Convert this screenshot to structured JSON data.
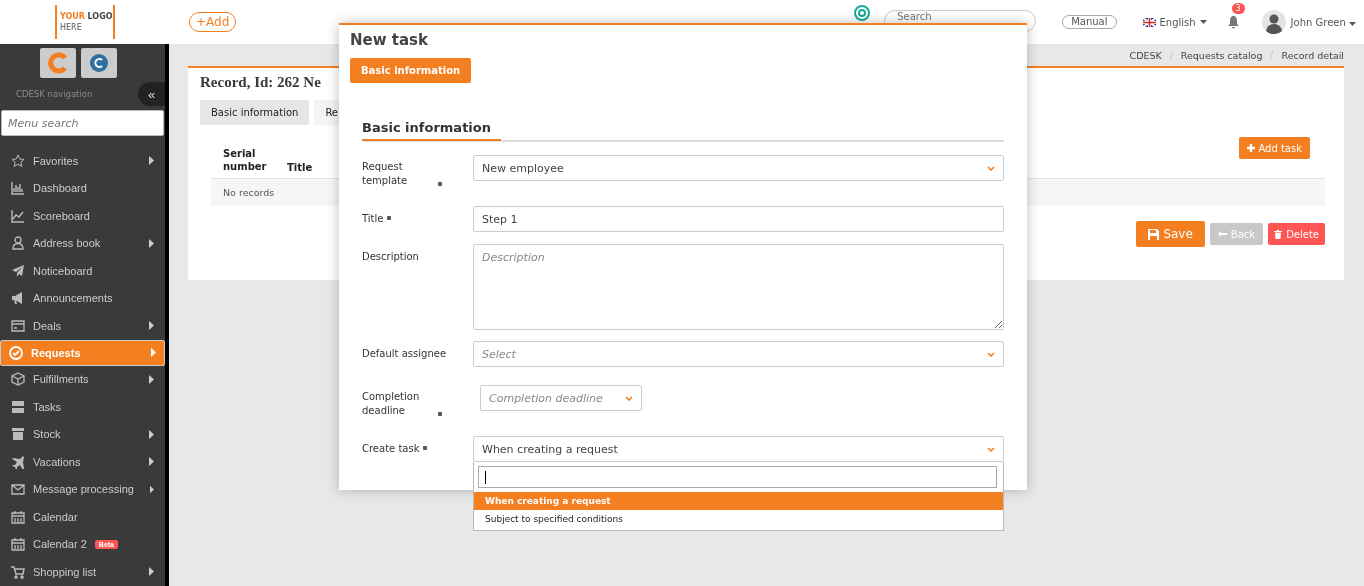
{
  "header": {
    "logo": {
      "word_1": "YOUR",
      "word_2": "LOGO",
      "word_3": "HERE"
    },
    "add_button": "+Add",
    "search": {
      "placeholder": "Search"
    },
    "manual_button": "Manual",
    "language": "English",
    "notifications": "3",
    "user": "John Green"
  },
  "sidebar": {
    "caption": "CDESK navigation",
    "collapse": "«",
    "menu_search": {
      "placeholder": "Menu search"
    },
    "items": [
      {
        "label": "Favorites",
        "submenu": true,
        "selected": false
      },
      {
        "label": "Dashboard",
        "submenu": false,
        "selected": false
      },
      {
        "label": "Scoreboard",
        "submenu": false,
        "selected": false
      },
      {
        "label": "Address book",
        "submenu": true,
        "selected": false
      },
      {
        "label": "Noticeboard",
        "submenu": false,
        "selected": false
      },
      {
        "label": "Announcements",
        "submenu": false,
        "selected": false
      },
      {
        "label": "Deals",
        "submenu": true,
        "selected": false
      },
      {
        "label": "Requests",
        "submenu": true,
        "selected": true
      },
      {
        "label": "Fulfillments",
        "submenu": true,
        "selected": false
      },
      {
        "label": "Tasks",
        "submenu": false,
        "selected": false
      },
      {
        "label": "Stock",
        "submenu": true,
        "selected": false
      },
      {
        "label": "Vacations",
        "submenu": true,
        "selected": false
      },
      {
        "label": "Message processing",
        "submenu": true,
        "selected": false
      },
      {
        "label": "Calendar",
        "submenu": false,
        "selected": false
      },
      {
        "label": "Calendar 2",
        "submenu": false,
        "selected": false,
        "badge": "Beta"
      },
      {
        "label": "Shopping list",
        "submenu": true,
        "selected": false
      }
    ]
  },
  "breadcrumb": [
    "CDESK",
    "Requests catalog",
    "Record detail"
  ],
  "record": {
    "title": "Record, Id: 262 Ne",
    "tabs": [
      {
        "label": "Basic information",
        "selected": true
      },
      {
        "label": "Re",
        "selected": false
      }
    ],
    "add_task": "Add task",
    "table": {
      "columns": [
        "Serial number",
        "Title"
      ],
      "empty": "No records"
    },
    "buttons": {
      "save": "Save",
      "back": "Back",
      "delete": "Delete"
    }
  },
  "modal": {
    "title": "New task",
    "tab": "Basic information",
    "section": "Basic information",
    "fields": [
      {
        "kind": "select",
        "label": "Request template",
        "required": true,
        "value": "New employee"
      },
      {
        "kind": "input",
        "label": "Title",
        "required": true,
        "value": "Step 1"
      },
      {
        "kind": "textarea",
        "label": "Description",
        "required": false,
        "placeholder": "Description"
      },
      {
        "kind": "select",
        "label": "Default assignee",
        "required": false,
        "placeholder": "Select"
      },
      {
        "kind": "small-select",
        "label": "Completion deadline",
        "required": true,
        "placeholder": "Completion deadline"
      },
      {
        "kind": "select",
        "label": "Create task",
        "required": true,
        "value": "When creating a request",
        "open": true
      }
    ],
    "dropdown_options": [
      {
        "label": "When creating a request",
        "selected": true
      },
      {
        "label": "Subject to specified conditions",
        "selected": false
      }
    ]
  }
}
